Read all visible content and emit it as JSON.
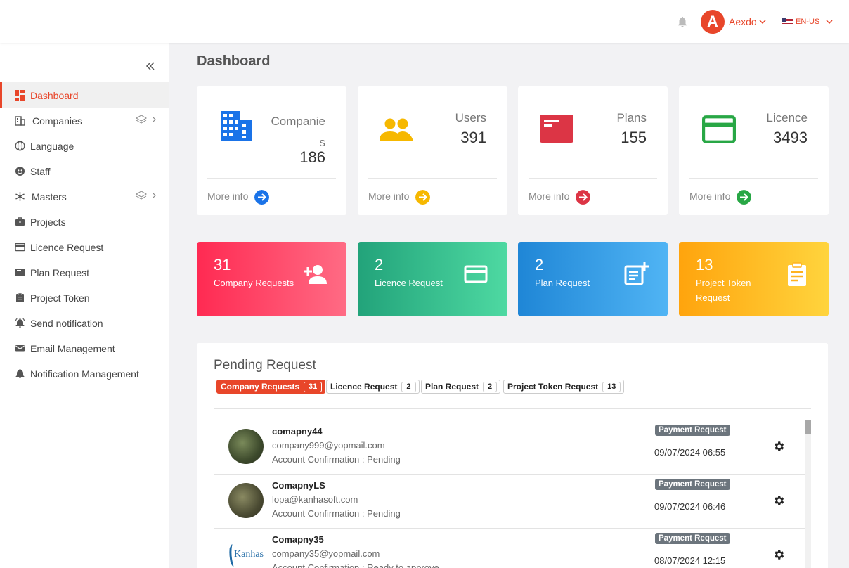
{
  "header": {
    "user_initial": "A",
    "user_name": "Aexdo",
    "language": "EN-US",
    "accent": "#e8462a"
  },
  "sidebar": {
    "items": [
      {
        "label": "Dashboard",
        "icon": "dashboard-icon",
        "active": true
      },
      {
        "label": "Companies",
        "icon": "building-icon",
        "has_submenu": true
      },
      {
        "label": "Language",
        "icon": "globe-icon"
      },
      {
        "label": "Staff",
        "icon": "staff-icon"
      },
      {
        "label": "Masters",
        "icon": "snowflake-icon",
        "has_submenu": true
      },
      {
        "label": "Projects",
        "icon": "briefcase-icon"
      },
      {
        "label": "Licence Request",
        "icon": "card-icon"
      },
      {
        "label": "Plan Request",
        "icon": "plan-icon"
      },
      {
        "label": "Project Token",
        "icon": "clipboard-icon"
      },
      {
        "label": "Send notification",
        "icon": "bell-ring-icon"
      },
      {
        "label": "Email Management",
        "icon": "envelope-icon"
      },
      {
        "label": "Notification Management",
        "icon": "bell-icon"
      }
    ]
  },
  "main": {
    "title": "Dashboard",
    "stats": [
      {
        "label_line1": "Companie",
        "label_line2": "s",
        "value": "186",
        "more": "More info",
        "color": "#1a73e8"
      },
      {
        "label_line1": "Users",
        "value": "391",
        "more": "More info",
        "color": "#f6b800"
      },
      {
        "label_line1": "Plans",
        "value": "155",
        "more": "More info",
        "color": "#dc3545"
      },
      {
        "label_line1": "Licence",
        "value": "3493",
        "more": "More info",
        "color": "#28a745"
      }
    ],
    "requests": [
      {
        "count": "31",
        "label": "Company Requests",
        "icon": "add-user-icon"
      },
      {
        "count": "2",
        "label": "Licence Request",
        "icon": "card-icon"
      },
      {
        "count": "2",
        "label": "Plan Request",
        "icon": "note-add-icon"
      },
      {
        "count": "13",
        "label": "Project Token Request",
        "icon": "clipboard-icon"
      }
    ]
  },
  "pending": {
    "title": "Pending Request",
    "tabs": [
      {
        "label": "Company Requests",
        "count": "31",
        "active": true
      },
      {
        "label": "Licence Request",
        "count": "2"
      },
      {
        "label": "Plan Request",
        "count": "2"
      },
      {
        "label": "Project Token Request",
        "count": "13"
      }
    ],
    "rows": [
      {
        "name": "comapny44",
        "email": "company999@yopmail.com",
        "status": "Account Confirmation : Pending",
        "badge": "Payment Request",
        "date": "09/07/2024 06:55"
      },
      {
        "name": "ComapnyLS",
        "email": "lopa@kanhasoft.com",
        "status": "Account Confirmation : Pending",
        "badge": "Payment Request",
        "date": "09/07/2024 06:46"
      },
      {
        "name": "Comapny35",
        "email": "company35@yopmail.com",
        "status": "Account Confirmation : Ready to approve",
        "badge": "Payment Request",
        "date": "08/07/2024 12:15"
      }
    ]
  }
}
